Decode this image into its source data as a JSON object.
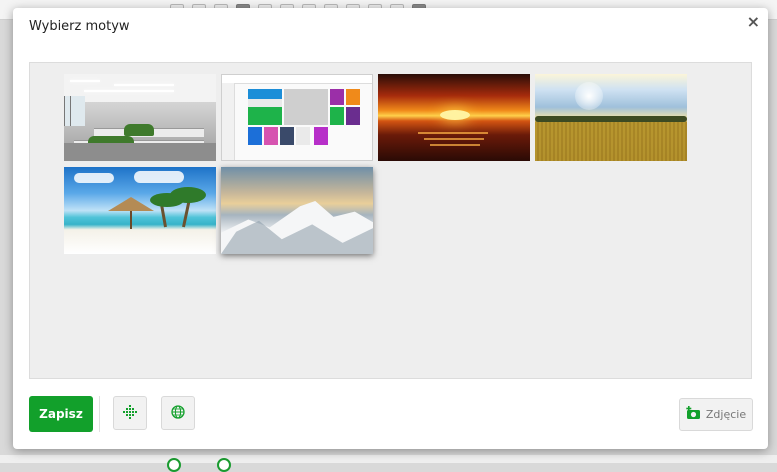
{
  "dialog": {
    "title": "Wybierz motyw",
    "close_icon": "close-icon",
    "close_glyph": "×"
  },
  "themes": [
    {
      "name": "office",
      "selected": false
    },
    {
      "name": "app-screenshot",
      "selected": false
    },
    {
      "name": "sunset",
      "selected": false
    },
    {
      "name": "wheat-field",
      "selected": false
    },
    {
      "name": "tropical-beach",
      "selected": false
    },
    {
      "name": "snowy-mountains",
      "selected": true
    }
  ],
  "footer": {
    "save_label": "Zapisz",
    "grid_icon": "dotted-grid-icon",
    "globe_icon": "globe-icon",
    "photo_icon": "add-photo-icon",
    "photo_label": "Zdjęcie"
  },
  "colors": {
    "accent": "#12a02b",
    "gallery_bg": "#eeeeee"
  }
}
